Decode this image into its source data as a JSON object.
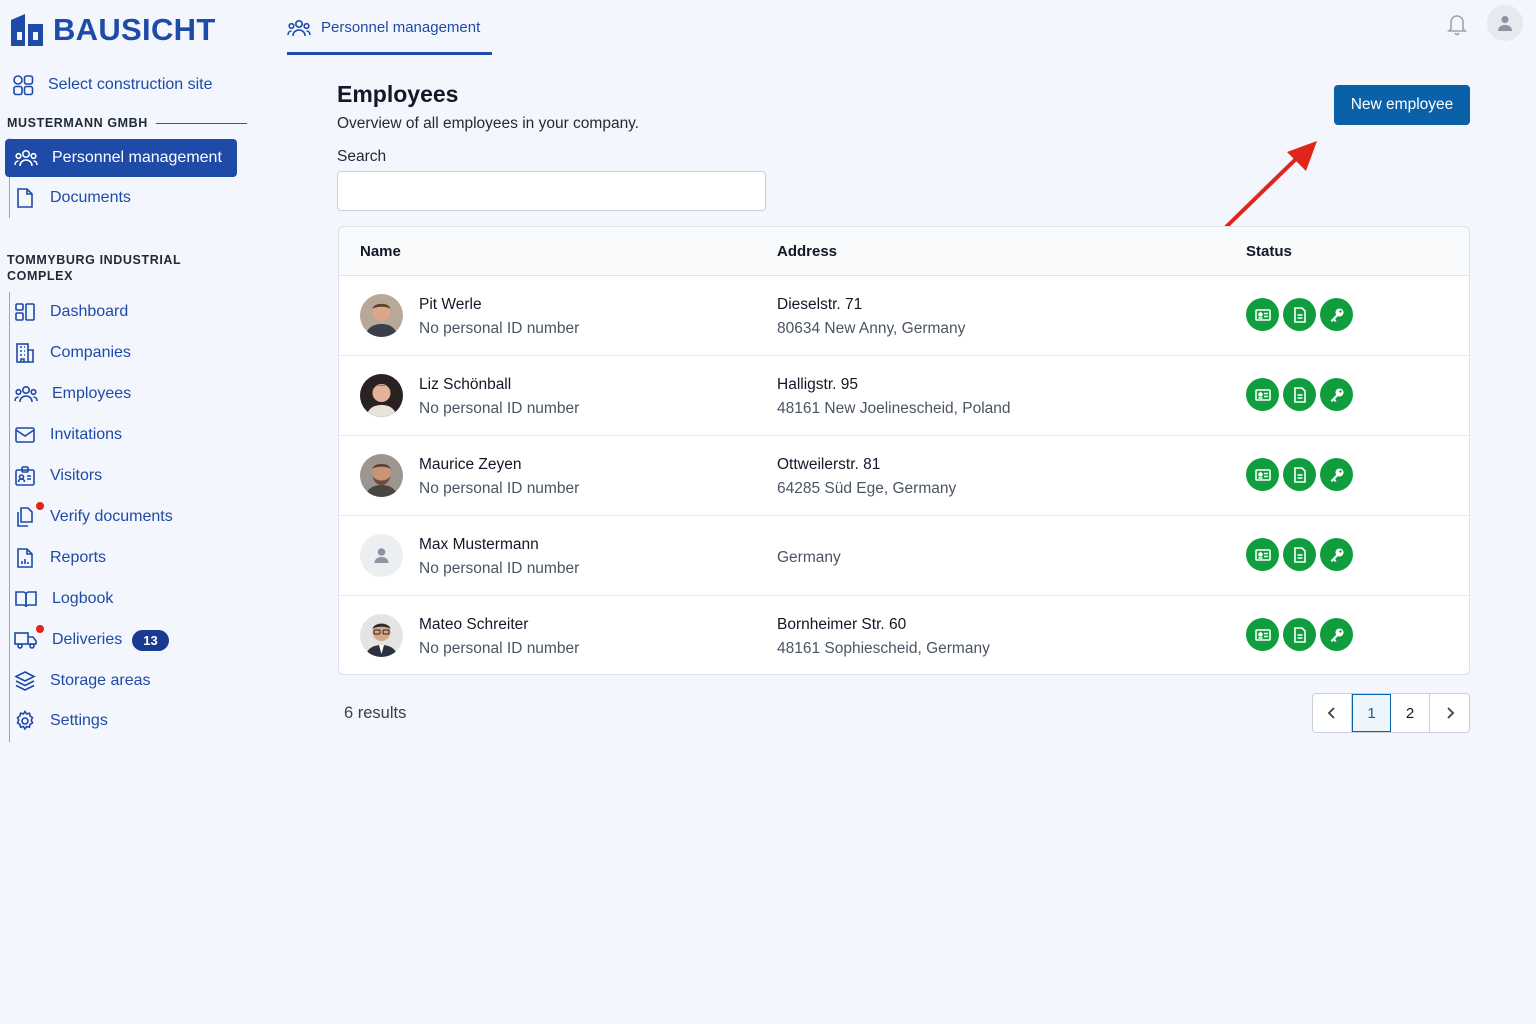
{
  "app": {
    "name": "BAUSICHT"
  },
  "sidebar": {
    "select_site_label": "Select construction site",
    "company_heading": "MUSTERMANN GMBH",
    "company_items": [
      {
        "label": "Personnel management",
        "icon": "users-icon",
        "active": true
      },
      {
        "label": "Documents",
        "icon": "document-icon",
        "active": false
      }
    ],
    "site_heading": "TOMMYBURG INDUSTRIAL COMPLEX",
    "site_items": [
      {
        "label": "Dashboard",
        "icon": "dashboard-icon"
      },
      {
        "label": "Companies",
        "icon": "building-icon"
      },
      {
        "label": "Employees",
        "icon": "users-icon"
      },
      {
        "label": "Invitations",
        "icon": "envelope-icon"
      },
      {
        "label": "Visitors",
        "icon": "visitor-badge-icon"
      },
      {
        "label": "Verify documents",
        "icon": "documents-copy-icon",
        "notification_dot": true
      },
      {
        "label": "Reports",
        "icon": "report-icon"
      },
      {
        "label": "Logbook",
        "icon": "book-icon"
      },
      {
        "label": "Deliveries",
        "icon": "truck-icon",
        "notification_dot": true,
        "badge": "13"
      },
      {
        "label": "Storage areas",
        "icon": "layers-icon"
      },
      {
        "label": "Settings",
        "icon": "gear-icon"
      }
    ]
  },
  "header": {
    "tab_label": "Personnel management",
    "bell_icon": "bell-icon",
    "avatar_icon": "user-avatar-icon"
  },
  "main": {
    "title": "Employees",
    "subtitle": "Overview of all employees in your company.",
    "search_label": "Search",
    "search_value": "",
    "search_placeholder": "",
    "new_button_label": "New employee",
    "columns": [
      "Name",
      "Address",
      "Status"
    ],
    "employees": [
      {
        "name": "Pit Werle",
        "id_text": "No personal ID number",
        "address_line1": "Dieselstr. 71",
        "address_line2": "80634 New Anny, Germany",
        "avatar": "photo"
      },
      {
        "name": "Liz Schönball",
        "id_text": "No personal ID number",
        "address_line1": "Halligstr. 95",
        "address_line2": "48161 New Joelinescheid, Poland",
        "avatar": "photo"
      },
      {
        "name": "Maurice Zeyen",
        "id_text": "No personal ID number",
        "address_line1": "Ottweilerstr. 81",
        "address_line2": "64285 Süd Ege, Germany",
        "avatar": "photo"
      },
      {
        "name": "Max Mustermann",
        "id_text": "No personal ID number",
        "address_line1": "",
        "address_line2": "Germany",
        "avatar": "placeholder"
      },
      {
        "name": "Mateo Schreiter",
        "id_text": "No personal ID number",
        "address_line1": "Bornheimer Str. 60",
        "address_line2": "48161 Sophiescheid, Germany",
        "avatar": "photo"
      }
    ],
    "status_icons": [
      "id-card-icon",
      "document-icon",
      "key-icon"
    ],
    "status_color": "#0f9d3e",
    "results_text": "6 results",
    "pagination": {
      "pages": [
        "1",
        "2"
      ],
      "current": "1"
    }
  },
  "colors": {
    "primary": "#1e4aa8",
    "button": "#0b61a8",
    "annotation_arrow": "#e0251b",
    "notification": "#e0251b"
  }
}
